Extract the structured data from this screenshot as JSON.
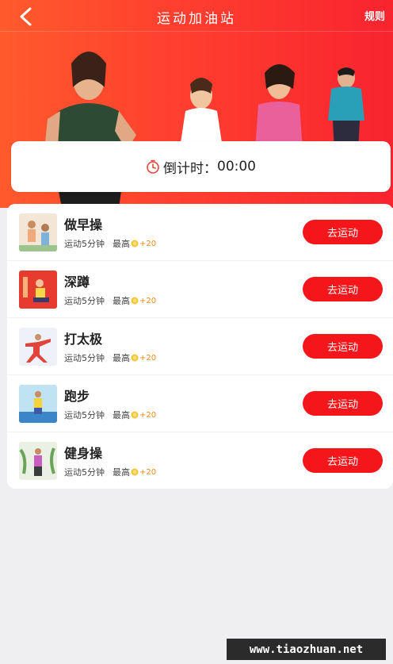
{
  "header": {
    "title": "运动加油站",
    "rules_label": "规则"
  },
  "countdown": {
    "label": "倒计时：",
    "value": "00:00"
  },
  "colors": {
    "accent": "#f4161a",
    "hero_left": "#ff5a2c",
    "hero_right": "#f8242f",
    "bonus": "#f08a1c"
  },
  "exercises": [
    {
      "name": "做早操",
      "duration": "运动5分钟",
      "max_label": "最高",
      "bonus": "+20",
      "button": "去运动",
      "icon": "morning-exercise-thumb"
    },
    {
      "name": "深蹲",
      "duration": "运动5分钟",
      "max_label": "最高",
      "bonus": "+20",
      "button": "去运动",
      "icon": "squat-thumb"
    },
    {
      "name": "打太极",
      "duration": "运动5分钟",
      "max_label": "最高",
      "bonus": "+20",
      "button": "去运动",
      "icon": "tai-chi-thumb"
    },
    {
      "name": "跑步",
      "duration": "运动5分钟",
      "max_label": "最高",
      "bonus": "+20",
      "button": "去运动",
      "icon": "running-thumb"
    },
    {
      "name": "健身操",
      "duration": "运动5分钟",
      "max_label": "最高",
      "bonus": "+20",
      "button": "去运动",
      "icon": "aerobics-thumb"
    }
  ],
  "watermark": "www.tiaozhuan.net"
}
